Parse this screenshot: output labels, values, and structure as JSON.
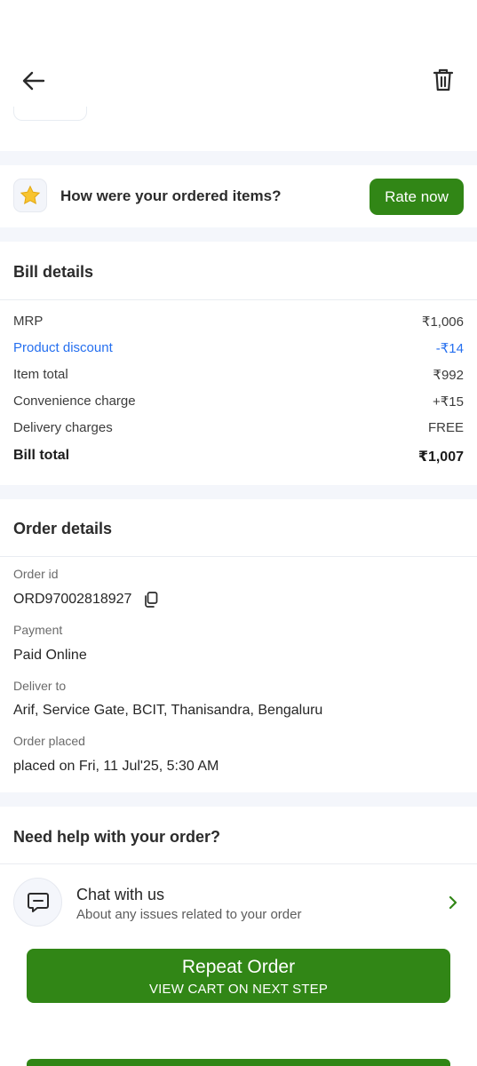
{
  "header": {
    "back_icon": "arrow-left-icon",
    "delete_icon": "trash-icon"
  },
  "rating": {
    "icon": "star-icon",
    "question": "How were your ordered items?",
    "button_label": "Rate now"
  },
  "bill": {
    "title": "Bill details",
    "rows": [
      {
        "label": "MRP",
        "value": "₹1,006"
      },
      {
        "label": "Product discount",
        "value": "-₹14"
      },
      {
        "label": "Item total",
        "value": "₹992"
      },
      {
        "label": "Convenience charge",
        "value": "+₹15"
      },
      {
        "label": "Delivery charges",
        "value": "FREE"
      },
      {
        "label": "Bill total",
        "value": "₹1,007"
      }
    ]
  },
  "order": {
    "title": "Order details",
    "id_label": "Order id",
    "id_value": "ORD97002818927",
    "payment_label": "Payment",
    "payment_value": "Paid Online",
    "deliver_label": "Deliver to",
    "deliver_value": "Arif, Service Gate, BCIT, Thanisandra, Bengaluru",
    "placed_label": "Order placed",
    "placed_value": "placed on Fri, 11 Jul'25, 5:30 AM"
  },
  "help": {
    "title": "Need help with your order?",
    "chat_title": "Chat with us",
    "chat_subtitle": "About any issues related to your order"
  },
  "repeat": {
    "label": "Repeat Order",
    "sublabel": "VIEW CART ON NEXT STEP"
  },
  "colors": {
    "brand_green": "#318616",
    "discount_blue": "#256fef",
    "section_gap": "#f4f6fb"
  }
}
